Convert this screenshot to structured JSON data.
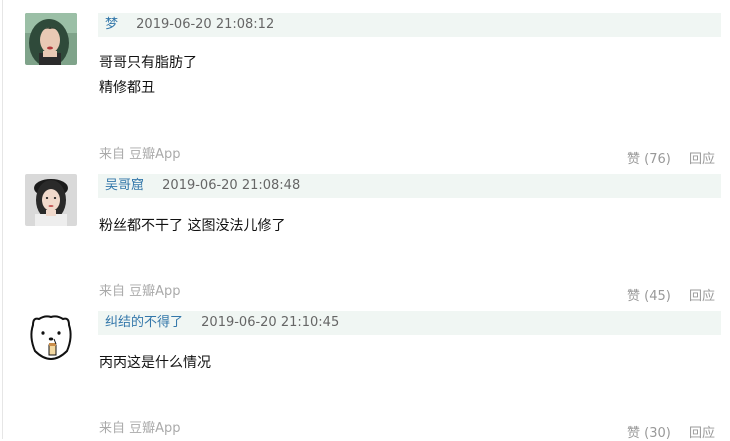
{
  "comments": [
    {
      "author": "梦",
      "time": "2019-06-20 21:08:12",
      "lines": [
        "哥哥只有脂肪了",
        "精修都丑"
      ],
      "source": "来自 豆瓣App",
      "like_label": "赞 (76)",
      "reply_label": "回应",
      "avatar": "girl-green-hair-photo"
    },
    {
      "author": "吴哥窟",
      "time": "2019-06-20 21:08:48",
      "lines": [
        "粉丝都不干了 这图没法儿修了"
      ],
      "source": "来自 豆瓣App",
      "like_label": "赞 (45)",
      "reply_label": "回应",
      "avatar": "girl-black-beret-photo"
    },
    {
      "author": "纠结的不得了",
      "time": "2019-06-20 21:10:45",
      "lines": [
        "丙丙这是什么情况"
      ],
      "source": "来自 豆瓣App",
      "like_label": "赞 (30)",
      "reply_label": "回应",
      "avatar": "cartoon-bear-icon"
    }
  ],
  "colors": {
    "author_link": "#3377aa",
    "meta_bar_bg": "#f0f6f3",
    "muted_text": "#aaaaaa"
  }
}
